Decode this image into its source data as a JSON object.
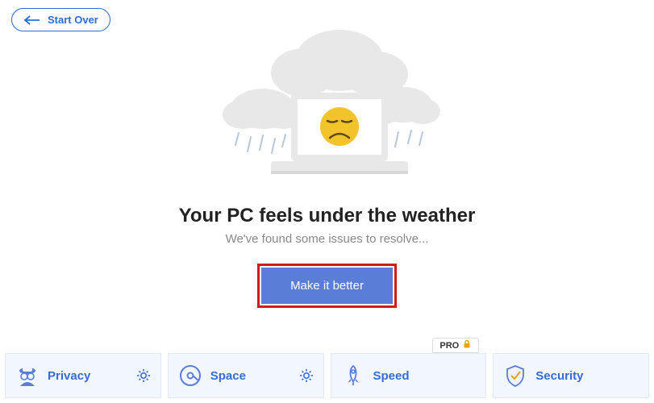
{
  "header": {
    "start_over": "Start Over"
  },
  "main": {
    "headline": "Your PC feels under the weather",
    "subline": "We've found some issues to resolve...",
    "cta_label": "Make it better"
  },
  "cards": {
    "privacy": {
      "label": "Privacy",
      "has_settings": true
    },
    "space": {
      "label": "Space",
      "has_settings": true
    },
    "speed": {
      "label": "Speed",
      "pro": true,
      "pro_label": "PRO"
    },
    "security": {
      "label": "Security"
    }
  }
}
